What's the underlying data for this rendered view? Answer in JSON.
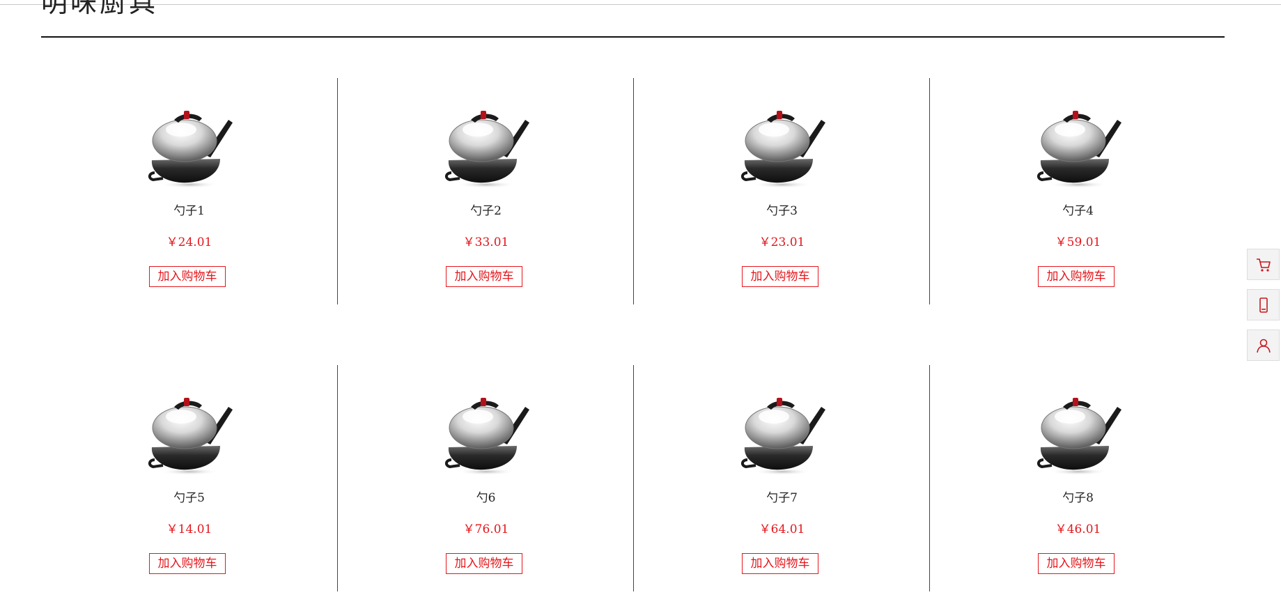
{
  "section": {
    "title": "明味厨具"
  },
  "products": [
    {
      "name": "勺子1",
      "price": "￥24.01",
      "button_label": "加入购物车"
    },
    {
      "name": "勺子2",
      "price": "￥33.01",
      "button_label": "加入购物车"
    },
    {
      "name": "勺子3",
      "price": "￥23.01",
      "button_label": "加入购物车"
    },
    {
      "name": "勺子4",
      "price": "￥59.01",
      "button_label": "加入购物车"
    },
    {
      "name": "勺子5",
      "price": "￥14.01",
      "button_label": "加入购物车"
    },
    {
      "name": "勺6",
      "price": "￥76.01",
      "button_label": "加入购物车"
    },
    {
      "name": "勺子7",
      "price": "￥64.01",
      "button_label": "加入购物车"
    },
    {
      "name": "勺子8",
      "price": "￥46.01",
      "button_label": "加入购物车"
    }
  ],
  "side_toolbar": {
    "icons": [
      "cart-icon",
      "mobile-icon",
      "user-icon"
    ]
  },
  "colors": {
    "accent": "#e4161b",
    "divider": "#444444",
    "text": "#222222"
  }
}
